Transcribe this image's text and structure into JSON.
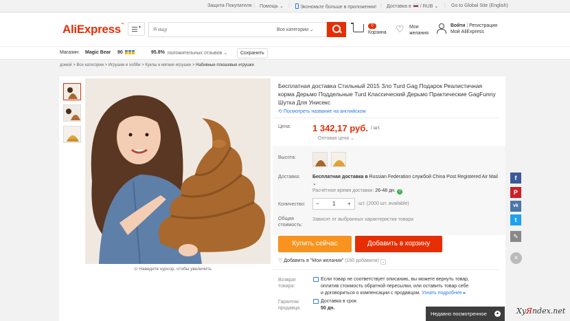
{
  "topbar": {
    "buyer_protection": "Защита Покупателя",
    "help": "Помощь ⌄",
    "app_promo": "Экономьте больше в приложении!",
    "ship_to": "Доставка в",
    "currency": "/ RUB ⌄",
    "global_site": "Go to Global Site (English)"
  },
  "header": {
    "logo": "AliExpress",
    "search_placeholder": "Я ищу",
    "all_categories": "Все категории ⌄",
    "cart_count": "0",
    "cart_label": "Корзина",
    "wishlist_label_1": "Мои",
    "wishlist_label_2": "желания",
    "signin": "Войти",
    "register": "Регистрация",
    "my_aliexpress": "Мой AliExpress"
  },
  "store": {
    "label": "Магазин:",
    "name": "Magic Bear",
    "score": "90",
    "feedback_pct": "95.8%",
    "feedback_text": "положительных отзывов ⌄",
    "save": "Сохранить"
  },
  "breadcrumb": {
    "home": "домой",
    "cat1": "Все категории",
    "cat2": "Игрушки и хобби",
    "cat3": "Куклы и мягкие игрушки",
    "current": "Набивные плюшевые игрушки",
    "sep": ">"
  },
  "product": {
    "title": "Бесплатная доставка Стильный 2015 Зло Turd Gag Подарок Реалистичная корма Дерьмо Поддельные Turd Классический Дерьмо Практические GagFunny Шутка Для Унисекс",
    "translate": "Посмотреть название на английском",
    "zoom_hint": "Наведите курсор, чтобы увеличить",
    "price_label": "Цена:",
    "price": "1 342,17 руб.",
    "price_unit": "/ шт.",
    "wholesale": "Оптовая цена ⌄",
    "height_label": "Высота:",
    "delivery_label": "Доставка:",
    "delivery_prefix": "Бесплатная доставка в",
    "delivery_rest": " Russian Federation службой China Post Registered Air Mail ⌄",
    "eta_prefix": "Расчётное время доставки:",
    "eta_days": "26-48 дн.",
    "qty_label": "Количество:",
    "qty_minus": "−",
    "qty_value": "1",
    "qty_plus": "+",
    "qty_available": "шт. (2000 шт. available)",
    "total_label_1": "Общая",
    "total_label_2": "стоимость:",
    "total_note": "Зависит от выбранных характеристик товара",
    "buy_now": "Купить сейчас",
    "add_to_cart": "Добавить в корзину",
    "wishlist": "Добавить в \"Мои желания\"",
    "wishlist_count": "(160 добавили)",
    "return_label_1": "Возврат",
    "return_label_2": "товара:",
    "return_text_1": "Если товар не соответствует описанию, вы можете вернуть товар,",
    "return_text_2": "оплатив стоимость обратной пересылки, или оставить товар себе",
    "return_text_3": "и договориться о компенсации с продавцом.",
    "return_more": "Узнать подробнее ▸",
    "guarantee_label_1": "Гарантии",
    "guarantee_label_2": "продавца:",
    "guarantee_text": "Доставка в срок",
    "guarantee_days": "50 дн."
  },
  "recently_viewed": "Недавно посмотренное",
  "watermark_a": "Xy",
  "watermark_b": "Я",
  "watermark_c": "ndex.net",
  "social": {
    "fb": "f",
    "pin": "P",
    "vk": "vk",
    "tw": "t",
    "edit": "✎",
    "close": "×"
  },
  "colors": {
    "accent": "#e62e04",
    "buy": "#f7931e",
    "link": "#2a7ae2",
    "fb": "#3b5998",
    "pin": "#cb2027",
    "vk": "#4a76a8",
    "tw": "#1da1f2"
  }
}
